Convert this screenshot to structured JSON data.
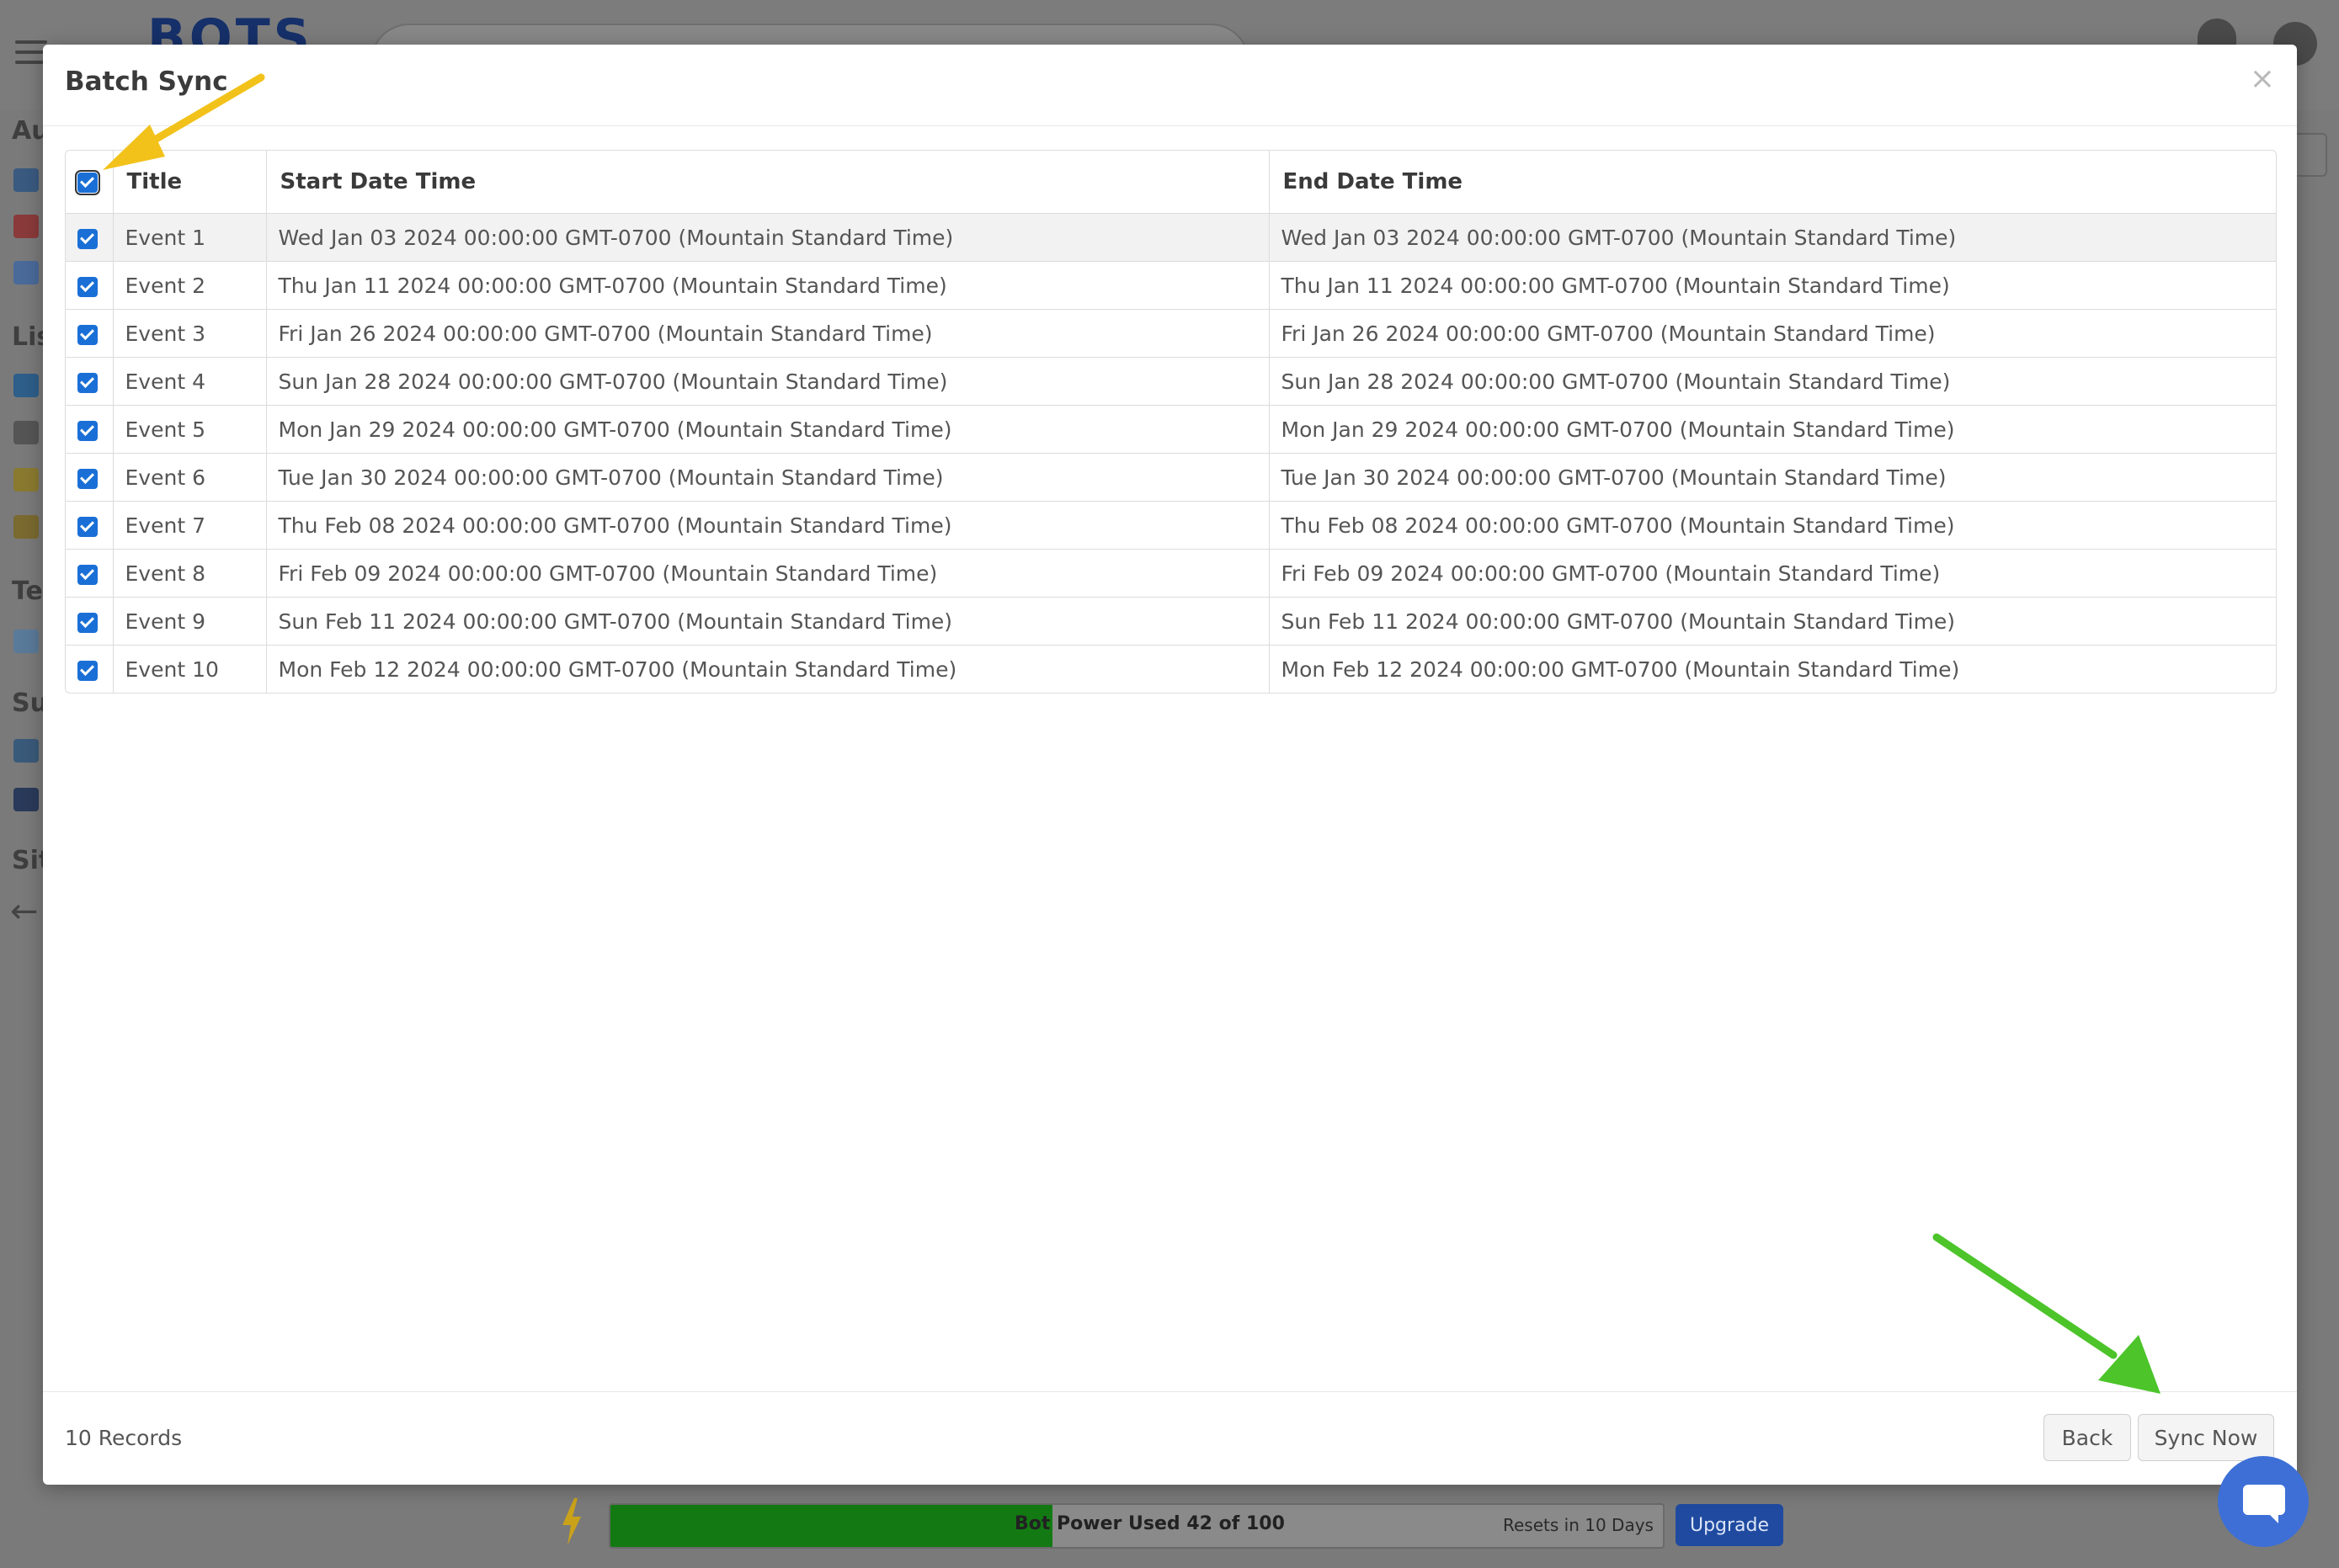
{
  "app": {
    "logo_text": "BOTS"
  },
  "sidebar": {
    "labels": [
      "Au",
      "Lis",
      "Te",
      "Su",
      "Sit"
    ]
  },
  "modal": {
    "title": "Batch Sync",
    "close_label": "×",
    "columns": [
      "Title",
      "Start Date Time",
      "End Date Time"
    ],
    "rows": [
      {
        "checked": true,
        "title": "Event 1",
        "start": "Wed Jan 03 2024 00:00:00 GMT-0700 (Mountain Standard Time)",
        "end": "Wed Jan 03 2024 00:00:00 GMT-0700 (Mountain Standard Time)"
      },
      {
        "checked": true,
        "title": "Event 2",
        "start": "Thu Jan 11 2024 00:00:00 GMT-0700 (Mountain Standard Time)",
        "end": "Thu Jan 11 2024 00:00:00 GMT-0700 (Mountain Standard Time)"
      },
      {
        "checked": true,
        "title": "Event 3",
        "start": "Fri Jan 26 2024 00:00:00 GMT-0700 (Mountain Standard Time)",
        "end": "Fri Jan 26 2024 00:00:00 GMT-0700 (Mountain Standard Time)"
      },
      {
        "checked": true,
        "title": "Event 4",
        "start": "Sun Jan 28 2024 00:00:00 GMT-0700 (Mountain Standard Time)",
        "end": "Sun Jan 28 2024 00:00:00 GMT-0700 (Mountain Standard Time)"
      },
      {
        "checked": true,
        "title": "Event 5",
        "start": "Mon Jan 29 2024 00:00:00 GMT-0700 (Mountain Standard Time)",
        "end": "Mon Jan 29 2024 00:00:00 GMT-0700 (Mountain Standard Time)"
      },
      {
        "checked": true,
        "title": "Event 6",
        "start": "Tue Jan 30 2024 00:00:00 GMT-0700 (Mountain Standard Time)",
        "end": "Tue Jan 30 2024 00:00:00 GMT-0700 (Mountain Standard Time)"
      },
      {
        "checked": true,
        "title": "Event 7",
        "start": "Thu Feb 08 2024 00:00:00 GMT-0700 (Mountain Standard Time)",
        "end": "Thu Feb 08 2024 00:00:00 GMT-0700 (Mountain Standard Time)"
      },
      {
        "checked": true,
        "title": "Event 8",
        "start": "Fri Feb 09 2024 00:00:00 GMT-0700 (Mountain Standard Time)",
        "end": "Fri Feb 09 2024 00:00:00 GMT-0700 (Mountain Standard Time)"
      },
      {
        "checked": true,
        "title": "Event 9",
        "start": "Sun Feb 11 2024 00:00:00 GMT-0700 (Mountain Standard Time)",
        "end": "Sun Feb 11 2024 00:00:00 GMT-0700 (Mountain Standard Time)"
      },
      {
        "checked": true,
        "title": "Event 10",
        "start": "Mon Feb 12 2024 00:00:00 GMT-0700 (Mountain Standard Time)",
        "end": "Mon Feb 12 2024 00:00:00 GMT-0700 (Mountain Standard Time)"
      }
    ],
    "footer": {
      "records_label": "10 Records",
      "back_label": "Back",
      "sync_label": "Sync Now"
    }
  },
  "power_bar": {
    "label": "Bot Power Used 42 of 100",
    "used": 42,
    "total": 100,
    "reset_label": "Resets in 10 Days",
    "upgrade_label": "Upgrade"
  },
  "colors": {
    "accent": "#1a6fd6",
    "power_fill": "#137a13",
    "upgrade": "#1f4aa0",
    "chat": "#3d6fd6",
    "arrow_yellow": "#f2c21b",
    "arrow_green": "#4cc42a"
  },
  "icons": {
    "menu": "hamburger-icon",
    "close": "close-icon",
    "bolt": "lightning-icon",
    "chat": "chat-icon",
    "notification": "bell-icon",
    "profile": "avatar-icon",
    "back": "arrow-left-icon"
  }
}
